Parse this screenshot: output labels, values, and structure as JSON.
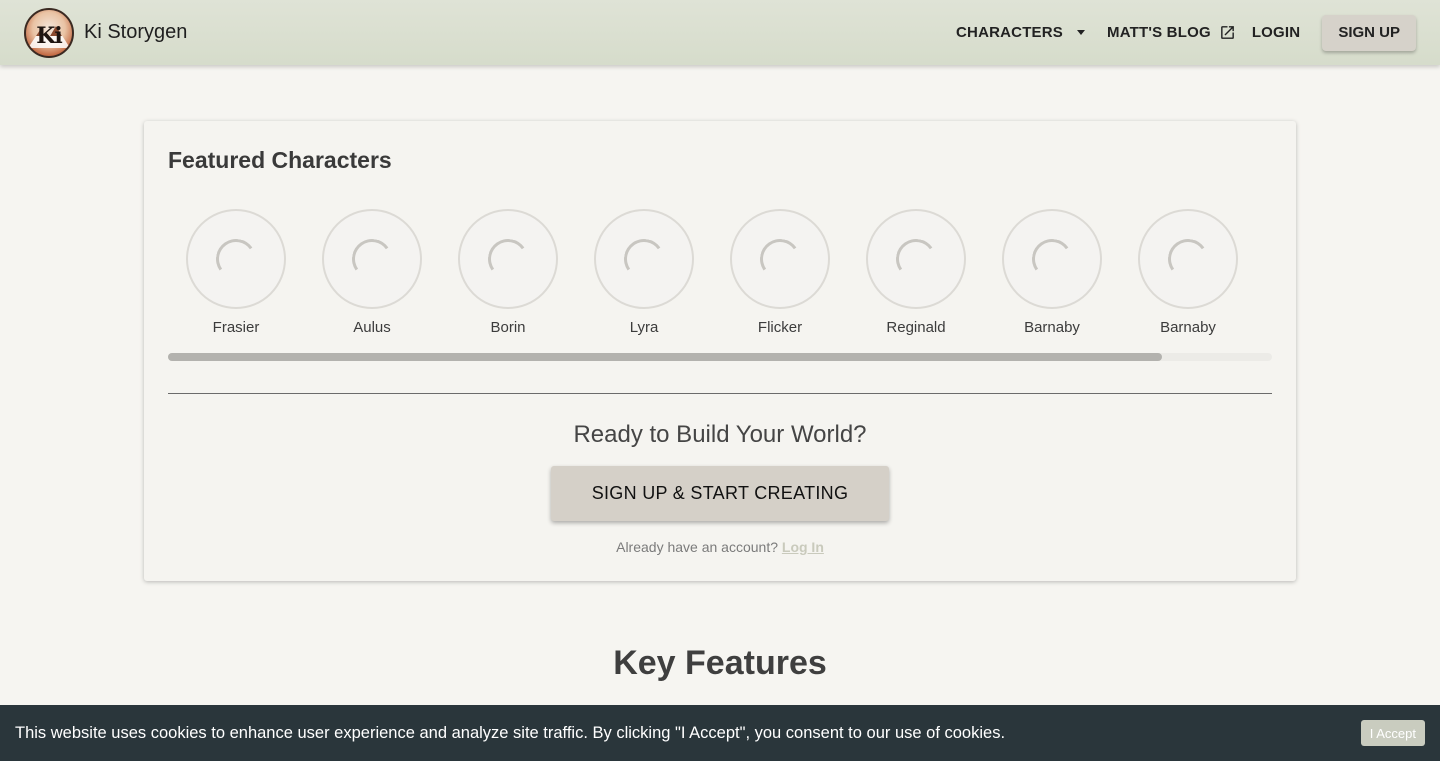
{
  "header": {
    "brand": "Ki Storygen",
    "logo_text": "Ki",
    "nav": {
      "characters": "CHARACTERS",
      "blog": "MATT'S BLOG",
      "login": "LOGIN",
      "signup": "SIGN UP"
    },
    "icons": {
      "characters_dropdown": "caret-down-icon",
      "blog_external": "external-link-icon"
    }
  },
  "featured": {
    "title": "Featured Characters",
    "characters": [
      {
        "name": "Frasier"
      },
      {
        "name": "Aulus"
      },
      {
        "name": "Borin"
      },
      {
        "name": "Lyra"
      },
      {
        "name": "Flicker"
      },
      {
        "name": "Reginald"
      },
      {
        "name": "Barnaby"
      },
      {
        "name": "Barnaby"
      }
    ],
    "scroll_fraction": 0.9
  },
  "cta": {
    "heading": "Ready to Build Your World?",
    "button": "SIGN UP & START CREATING",
    "login_prompt": "Already have an account?",
    "login_link": "Log In"
  },
  "features": {
    "title": "Key Features"
  },
  "cookie": {
    "message": "This website uses cookies to enhance user experience and analyze site traffic. By clicking \"I Accept\", you consent to our use of cookies.",
    "accept": "I Accept"
  },
  "colors": {
    "header_bg": "#d8ddcd",
    "page_bg": "#f6f5f1",
    "button_bg": "#d5d0c8",
    "cookie_bg": "#2a363b",
    "accept_bg": "#c9ccbf"
  }
}
